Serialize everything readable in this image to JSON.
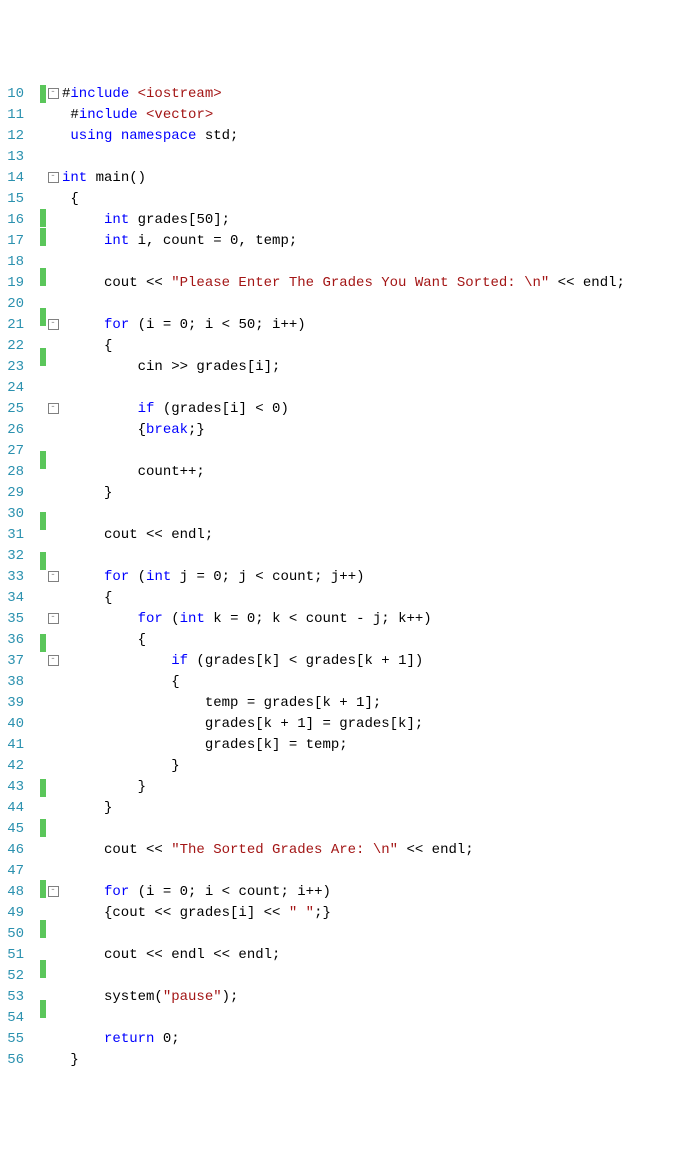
{
  "lines": [
    {
      "n": 10,
      "chg": true,
      "fold": "-",
      "t": [
        [
          "txt",
          "#"
        ],
        [
          "kw",
          "include"
        ],
        [
          "txt",
          " "
        ],
        [
          "inc",
          "<iostream>"
        ]
      ]
    },
    {
      "n": 11,
      "chg": false,
      "fold": "",
      "t": [
        [
          "txt",
          " #"
        ],
        [
          "kw",
          "include"
        ],
        [
          "txt",
          " "
        ],
        [
          "inc",
          "<vector>"
        ]
      ]
    },
    {
      "n": 12,
      "chg": false,
      "fold": "",
      "t": [
        [
          "txt",
          " "
        ],
        [
          "kw",
          "using"
        ],
        [
          "txt",
          " "
        ],
        [
          "kw",
          "namespace"
        ],
        [
          "txt",
          " std;"
        ]
      ]
    },
    {
      "n": 13,
      "chg": false,
      "fold": "",
      "t": [
        [
          "txt",
          ""
        ]
      ]
    },
    {
      "n": 14,
      "chg": false,
      "fold": "-",
      "t": [
        [
          "kw",
          "int"
        ],
        [
          "txt",
          " main()"
        ]
      ]
    },
    {
      "n": 15,
      "chg": false,
      "fold": "",
      "t": [
        [
          "txt",
          " {"
        ]
      ]
    },
    {
      "n": 16,
      "chg": true,
      "fold": "",
      "t": [
        [
          "txt",
          "     "
        ],
        [
          "kw",
          "int"
        ],
        [
          "txt",
          " grades[50];"
        ]
      ]
    },
    {
      "n": 17,
      "chg": true,
      "fold": "",
      "t": [
        [
          "txt",
          "     "
        ],
        [
          "kw",
          "int"
        ],
        [
          "txt",
          " i, count = 0, temp;"
        ]
      ]
    },
    {
      "n": 18,
      "chg": false,
      "fold": "",
      "t": [
        [
          "txt",
          ""
        ]
      ]
    },
    {
      "n": 19,
      "chg": true,
      "fold": "",
      "t": [
        [
          "txt",
          "     cout << "
        ],
        [
          "str",
          "\"Please Enter The Grades You Want Sorted: \\n\""
        ],
        [
          "txt",
          " << endl;"
        ]
      ]
    },
    {
      "n": 20,
      "chg": false,
      "fold": "",
      "t": [
        [
          "txt",
          ""
        ]
      ]
    },
    {
      "n": 21,
      "chg": true,
      "fold": "-",
      "t": [
        [
          "txt",
          "     "
        ],
        [
          "kw",
          "for"
        ],
        [
          "txt",
          " (i = 0; i < 50; i++)"
        ]
      ]
    },
    {
      "n": 22,
      "chg": false,
      "fold": "",
      "t": [
        [
          "txt",
          "     {"
        ]
      ]
    },
    {
      "n": 23,
      "chg": true,
      "fold": "",
      "t": [
        [
          "txt",
          "         cin >> grades[i];"
        ]
      ]
    },
    {
      "n": 24,
      "chg": false,
      "fold": "",
      "t": [
        [
          "txt",
          ""
        ]
      ]
    },
    {
      "n": 25,
      "chg": false,
      "fold": "-",
      "t": [
        [
          "txt",
          "         "
        ],
        [
          "kw",
          "if"
        ],
        [
          "txt",
          " (grades[i] < 0)"
        ]
      ]
    },
    {
      "n": 26,
      "chg": false,
      "fold": "",
      "t": [
        [
          "txt",
          "         {"
        ],
        [
          "kw",
          "break"
        ],
        [
          "txt",
          ";}"
        ]
      ]
    },
    {
      "n": 27,
      "chg": false,
      "fold": "",
      "t": [
        [
          "txt",
          ""
        ]
      ]
    },
    {
      "n": 28,
      "chg": true,
      "fold": "",
      "t": [
        [
          "txt",
          "         count++;"
        ]
      ]
    },
    {
      "n": 29,
      "chg": false,
      "fold": "",
      "t": [
        [
          "txt",
          "     }"
        ]
      ]
    },
    {
      "n": 30,
      "chg": false,
      "fold": "",
      "t": [
        [
          "txt",
          ""
        ]
      ]
    },
    {
      "n": 31,
      "chg": true,
      "fold": "",
      "t": [
        [
          "txt",
          "     cout << endl;"
        ]
      ]
    },
    {
      "n": 32,
      "chg": false,
      "fold": "",
      "t": [
        [
          "txt",
          ""
        ]
      ]
    },
    {
      "n": 33,
      "chg": true,
      "fold": "-",
      "t": [
        [
          "txt",
          "     "
        ],
        [
          "kw",
          "for"
        ],
        [
          "txt",
          " ("
        ],
        [
          "kw",
          "int"
        ],
        [
          "txt",
          " j = 0; j < count; j++)"
        ]
      ]
    },
    {
      "n": 34,
      "chg": false,
      "fold": "",
      "t": [
        [
          "txt",
          "     {"
        ]
      ]
    },
    {
      "n": 35,
      "chg": false,
      "fold": "-",
      "t": [
        [
          "txt",
          "         "
        ],
        [
          "kw",
          "for"
        ],
        [
          "txt",
          " ("
        ],
        [
          "kw",
          "int"
        ],
        [
          "txt",
          " k = 0; k < count - j; k++)"
        ]
      ]
    },
    {
      "n": 36,
      "chg": false,
      "fold": "",
      "t": [
        [
          "txt",
          "         {"
        ]
      ]
    },
    {
      "n": 37,
      "chg": true,
      "fold": "-",
      "t": [
        [
          "txt",
          "             "
        ],
        [
          "kw",
          "if"
        ],
        [
          "txt",
          " (grades[k] < grades[k + 1])"
        ]
      ]
    },
    {
      "n": 38,
      "chg": false,
      "fold": "",
      "t": [
        [
          "txt",
          "             {"
        ]
      ]
    },
    {
      "n": 39,
      "chg": false,
      "fold": "",
      "t": [
        [
          "txt",
          "                 temp = grades[k + 1];"
        ]
      ]
    },
    {
      "n": 40,
      "chg": false,
      "fold": "",
      "t": [
        [
          "txt",
          "                 grades[k + 1] = grades[k];"
        ]
      ]
    },
    {
      "n": 41,
      "chg": false,
      "fold": "",
      "t": [
        [
          "txt",
          "                 grades[k] = temp;"
        ]
      ]
    },
    {
      "n": 42,
      "chg": false,
      "fold": "",
      "t": [
        [
          "txt",
          "             }"
        ]
      ]
    },
    {
      "n": 43,
      "chg": false,
      "fold": "",
      "t": [
        [
          "txt",
          "         }"
        ]
      ]
    },
    {
      "n": 44,
      "chg": true,
      "fold": "",
      "t": [
        [
          "txt",
          "     }"
        ]
      ]
    },
    {
      "n": 45,
      "chg": false,
      "fold": "",
      "t": [
        [
          "txt",
          ""
        ]
      ]
    },
    {
      "n": 46,
      "chg": true,
      "fold": "",
      "t": [
        [
          "txt",
          "     cout << "
        ],
        [
          "str",
          "\"The Sorted Grades Are: \\n\""
        ],
        [
          "txt",
          " << endl;"
        ]
      ]
    },
    {
      "n": 47,
      "chg": false,
      "fold": "",
      "t": [
        [
          "txt",
          ""
        ]
      ]
    },
    {
      "n": 48,
      "chg": false,
      "fold": "-",
      "t": [
        [
          "txt",
          "     "
        ],
        [
          "kw",
          "for"
        ],
        [
          "txt",
          " (i = 0; i < count; i++)"
        ]
      ]
    },
    {
      "n": 49,
      "chg": true,
      "fold": "",
      "t": [
        [
          "txt",
          "     {cout << grades[i] << "
        ],
        [
          "str",
          "\" \""
        ],
        [
          "txt",
          ";}"
        ]
      ]
    },
    {
      "n": 50,
      "chg": false,
      "fold": "",
      "t": [
        [
          "txt",
          ""
        ]
      ]
    },
    {
      "n": 51,
      "chg": true,
      "fold": "",
      "t": [
        [
          "txt",
          "     cout << endl << endl;"
        ]
      ]
    },
    {
      "n": 52,
      "chg": false,
      "fold": "",
      "t": [
        [
          "txt",
          ""
        ]
      ]
    },
    {
      "n": 53,
      "chg": true,
      "fold": "",
      "t": [
        [
          "txt",
          "     system("
        ],
        [
          "str",
          "\"pause\""
        ],
        [
          "txt",
          ");"
        ]
      ]
    },
    {
      "n": 54,
      "chg": false,
      "fold": "",
      "t": [
        [
          "txt",
          ""
        ]
      ]
    },
    {
      "n": 55,
      "chg": true,
      "fold": "",
      "t": [
        [
          "txt",
          "     "
        ],
        [
          "kw",
          "return"
        ],
        [
          "txt",
          " 0;"
        ]
      ]
    },
    {
      "n": 56,
      "chg": false,
      "fold": "",
      "t": [
        [
          "txt",
          " }"
        ]
      ]
    }
  ]
}
